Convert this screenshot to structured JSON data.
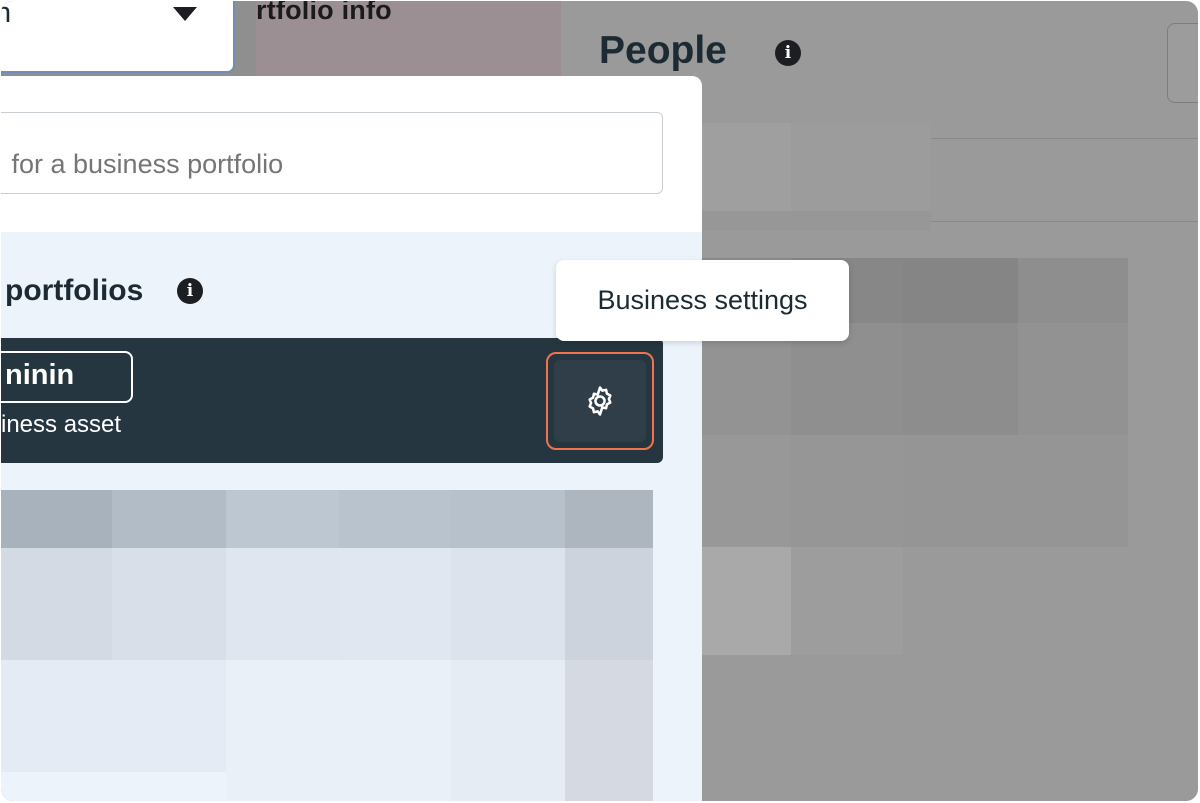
{
  "background_page": {
    "section_heading": "rtfolio info",
    "people_title": "People"
  },
  "selector": {
    "value": "n"
  },
  "popup": {
    "search_placeholder": " for a business portfolio",
    "section_title": "portfolios",
    "portfolio": {
      "name": "ninin",
      "subtitle": "iness asset",
      "settings_icon": "gear-icon"
    }
  },
  "tooltip": {
    "text": "Business settings"
  },
  "colors": {
    "highlight": "#f0734d",
    "card": "#263641",
    "panel": "#edf3fb"
  }
}
